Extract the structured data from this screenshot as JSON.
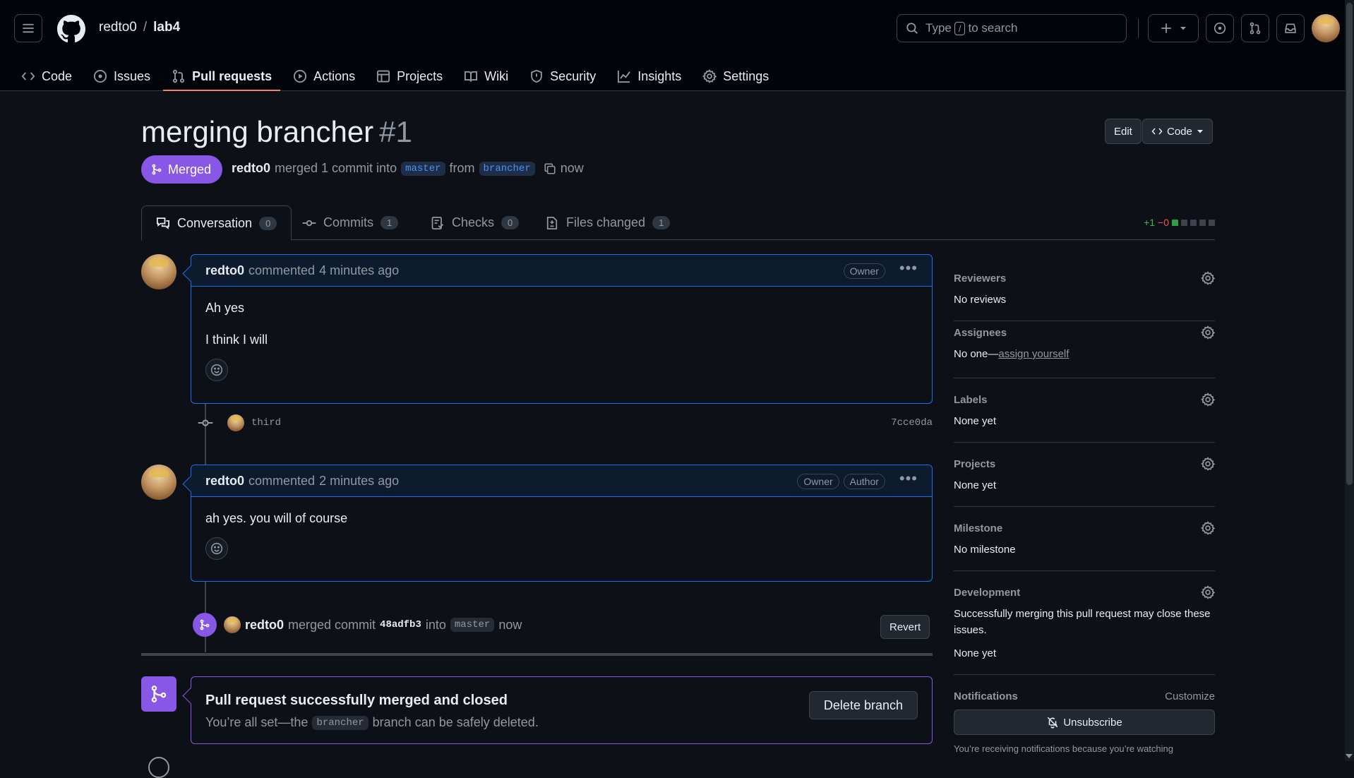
{
  "repo": {
    "owner": "redto0",
    "separator": "/",
    "name": "lab4"
  },
  "search": {
    "before": "Type",
    "key": "/",
    "after": "to search"
  },
  "nav": [
    {
      "label": "Code",
      "icon": "code-icon"
    },
    {
      "label": "Issues",
      "icon": "issue-opened-icon"
    },
    {
      "label": "Pull requests",
      "icon": "git-pull-request-icon",
      "active": true
    },
    {
      "label": "Actions",
      "icon": "play-icon"
    },
    {
      "label": "Projects",
      "icon": "table-icon"
    },
    {
      "label": "Wiki",
      "icon": "book-icon"
    },
    {
      "label": "Security",
      "icon": "shield-icon"
    },
    {
      "label": "Insights",
      "icon": "graph-icon"
    },
    {
      "label": "Settings",
      "icon": "gear-icon"
    }
  ],
  "pr": {
    "title": "merging brancher",
    "number": "#1",
    "edit_label": "Edit",
    "code_label": "Code",
    "state": "Merged",
    "meta": {
      "user": "redto0",
      "text1": "merged 1 commit into",
      "base": "master",
      "text2": "from",
      "head": "brancher",
      "time": "now"
    }
  },
  "tabs": [
    {
      "label": "Conversation",
      "count": "0"
    },
    {
      "label": "Commits",
      "count": "1"
    },
    {
      "label": "Checks",
      "count": "0"
    },
    {
      "label": "Files changed",
      "count": "1"
    }
  ],
  "diffstat": {
    "additions": "+1",
    "deletions": "−0"
  },
  "comments": [
    {
      "user": "redto0",
      "action": "commented",
      "time": "4 minutes ago",
      "badges": [
        "Owner"
      ],
      "lines": [
        "Ah yes",
        "I think I will"
      ]
    },
    {
      "user": "redto0",
      "action": "commented",
      "time": "2 minutes ago",
      "badges": [
        "Owner",
        "Author"
      ],
      "lines": [
        "ah yes. you will of course"
      ]
    }
  ],
  "commit_event": {
    "message": "third",
    "sha": "7cce0da"
  },
  "merge_event": {
    "user": "redto0",
    "text1": "merged commit",
    "sha": "48adfb3",
    "text2": "into",
    "branch": "master",
    "time": "now",
    "revert_label": "Revert"
  },
  "merge_box": {
    "title": "Pull request successfully merged and closed",
    "text1": "You’re all set—the",
    "branch": "brancher",
    "text2": "branch can be safely deleted.",
    "button": "Delete branch"
  },
  "sidebar": {
    "reviewers": {
      "title": "Reviewers",
      "value": "No reviews"
    },
    "assignees": {
      "title": "Assignees",
      "value": "No one—",
      "link": "assign yourself"
    },
    "labels": {
      "title": "Labels",
      "value": "None yet"
    },
    "projects": {
      "title": "Projects",
      "value": "None yet"
    },
    "milestone": {
      "title": "Milestone",
      "value": "No milestone"
    },
    "development": {
      "title": "Development",
      "desc": "Successfully merging this pull request may close these issues.",
      "value": "None yet"
    },
    "notifications": {
      "title": "Notifications",
      "customize": "Customize",
      "button": "Unsubscribe",
      "footer": "You’re receiving notifications because you’re watching"
    }
  },
  "colors": {
    "merged": "#8957e5",
    "accent": "#1f6feb",
    "underline": "#f78166"
  }
}
